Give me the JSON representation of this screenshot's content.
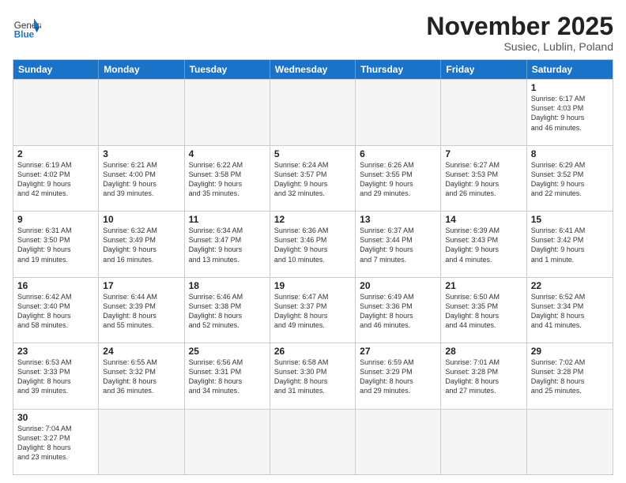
{
  "header": {
    "logo_text_general": "General",
    "logo_text_blue": "Blue",
    "month": "November 2025",
    "location": "Susiec, Lublin, Poland"
  },
  "days_of_week": [
    "Sunday",
    "Monday",
    "Tuesday",
    "Wednesday",
    "Thursday",
    "Friday",
    "Saturday"
  ],
  "rows": [
    [
      {
        "day": "",
        "info": ""
      },
      {
        "day": "",
        "info": ""
      },
      {
        "day": "",
        "info": ""
      },
      {
        "day": "",
        "info": ""
      },
      {
        "day": "",
        "info": ""
      },
      {
        "day": "",
        "info": ""
      },
      {
        "day": "1",
        "info": "Sunrise: 6:17 AM\nSunset: 4:03 PM\nDaylight: 9 hours\nand 46 minutes."
      }
    ],
    [
      {
        "day": "2",
        "info": "Sunrise: 6:19 AM\nSunset: 4:02 PM\nDaylight: 9 hours\nand 42 minutes."
      },
      {
        "day": "3",
        "info": "Sunrise: 6:21 AM\nSunset: 4:00 PM\nDaylight: 9 hours\nand 39 minutes."
      },
      {
        "day": "4",
        "info": "Sunrise: 6:22 AM\nSunset: 3:58 PM\nDaylight: 9 hours\nand 35 minutes."
      },
      {
        "day": "5",
        "info": "Sunrise: 6:24 AM\nSunset: 3:57 PM\nDaylight: 9 hours\nand 32 minutes."
      },
      {
        "day": "6",
        "info": "Sunrise: 6:26 AM\nSunset: 3:55 PM\nDaylight: 9 hours\nand 29 minutes."
      },
      {
        "day": "7",
        "info": "Sunrise: 6:27 AM\nSunset: 3:53 PM\nDaylight: 9 hours\nand 26 minutes."
      },
      {
        "day": "8",
        "info": "Sunrise: 6:29 AM\nSunset: 3:52 PM\nDaylight: 9 hours\nand 22 minutes."
      }
    ],
    [
      {
        "day": "9",
        "info": "Sunrise: 6:31 AM\nSunset: 3:50 PM\nDaylight: 9 hours\nand 19 minutes."
      },
      {
        "day": "10",
        "info": "Sunrise: 6:32 AM\nSunset: 3:49 PM\nDaylight: 9 hours\nand 16 minutes."
      },
      {
        "day": "11",
        "info": "Sunrise: 6:34 AM\nSunset: 3:47 PM\nDaylight: 9 hours\nand 13 minutes."
      },
      {
        "day": "12",
        "info": "Sunrise: 6:36 AM\nSunset: 3:46 PM\nDaylight: 9 hours\nand 10 minutes."
      },
      {
        "day": "13",
        "info": "Sunrise: 6:37 AM\nSunset: 3:44 PM\nDaylight: 9 hours\nand 7 minutes."
      },
      {
        "day": "14",
        "info": "Sunrise: 6:39 AM\nSunset: 3:43 PM\nDaylight: 9 hours\nand 4 minutes."
      },
      {
        "day": "15",
        "info": "Sunrise: 6:41 AM\nSunset: 3:42 PM\nDaylight: 9 hours\nand 1 minute."
      }
    ],
    [
      {
        "day": "16",
        "info": "Sunrise: 6:42 AM\nSunset: 3:40 PM\nDaylight: 8 hours\nand 58 minutes."
      },
      {
        "day": "17",
        "info": "Sunrise: 6:44 AM\nSunset: 3:39 PM\nDaylight: 8 hours\nand 55 minutes."
      },
      {
        "day": "18",
        "info": "Sunrise: 6:46 AM\nSunset: 3:38 PM\nDaylight: 8 hours\nand 52 minutes."
      },
      {
        "day": "19",
        "info": "Sunrise: 6:47 AM\nSunset: 3:37 PM\nDaylight: 8 hours\nand 49 minutes."
      },
      {
        "day": "20",
        "info": "Sunrise: 6:49 AM\nSunset: 3:36 PM\nDaylight: 8 hours\nand 46 minutes."
      },
      {
        "day": "21",
        "info": "Sunrise: 6:50 AM\nSunset: 3:35 PM\nDaylight: 8 hours\nand 44 minutes."
      },
      {
        "day": "22",
        "info": "Sunrise: 6:52 AM\nSunset: 3:34 PM\nDaylight: 8 hours\nand 41 minutes."
      }
    ],
    [
      {
        "day": "23",
        "info": "Sunrise: 6:53 AM\nSunset: 3:33 PM\nDaylight: 8 hours\nand 39 minutes."
      },
      {
        "day": "24",
        "info": "Sunrise: 6:55 AM\nSunset: 3:32 PM\nDaylight: 8 hours\nand 36 minutes."
      },
      {
        "day": "25",
        "info": "Sunrise: 6:56 AM\nSunset: 3:31 PM\nDaylight: 8 hours\nand 34 minutes."
      },
      {
        "day": "26",
        "info": "Sunrise: 6:58 AM\nSunset: 3:30 PM\nDaylight: 8 hours\nand 31 minutes."
      },
      {
        "day": "27",
        "info": "Sunrise: 6:59 AM\nSunset: 3:29 PM\nDaylight: 8 hours\nand 29 minutes."
      },
      {
        "day": "28",
        "info": "Sunrise: 7:01 AM\nSunset: 3:28 PM\nDaylight: 8 hours\nand 27 minutes."
      },
      {
        "day": "29",
        "info": "Sunrise: 7:02 AM\nSunset: 3:28 PM\nDaylight: 8 hours\nand 25 minutes."
      }
    ],
    [
      {
        "day": "30",
        "info": "Sunrise: 7:04 AM\nSunset: 3:27 PM\nDaylight: 8 hours\nand 23 minutes."
      },
      {
        "day": "",
        "info": ""
      },
      {
        "day": "",
        "info": ""
      },
      {
        "day": "",
        "info": ""
      },
      {
        "day": "",
        "info": ""
      },
      {
        "day": "",
        "info": ""
      },
      {
        "day": "",
        "info": ""
      }
    ]
  ]
}
